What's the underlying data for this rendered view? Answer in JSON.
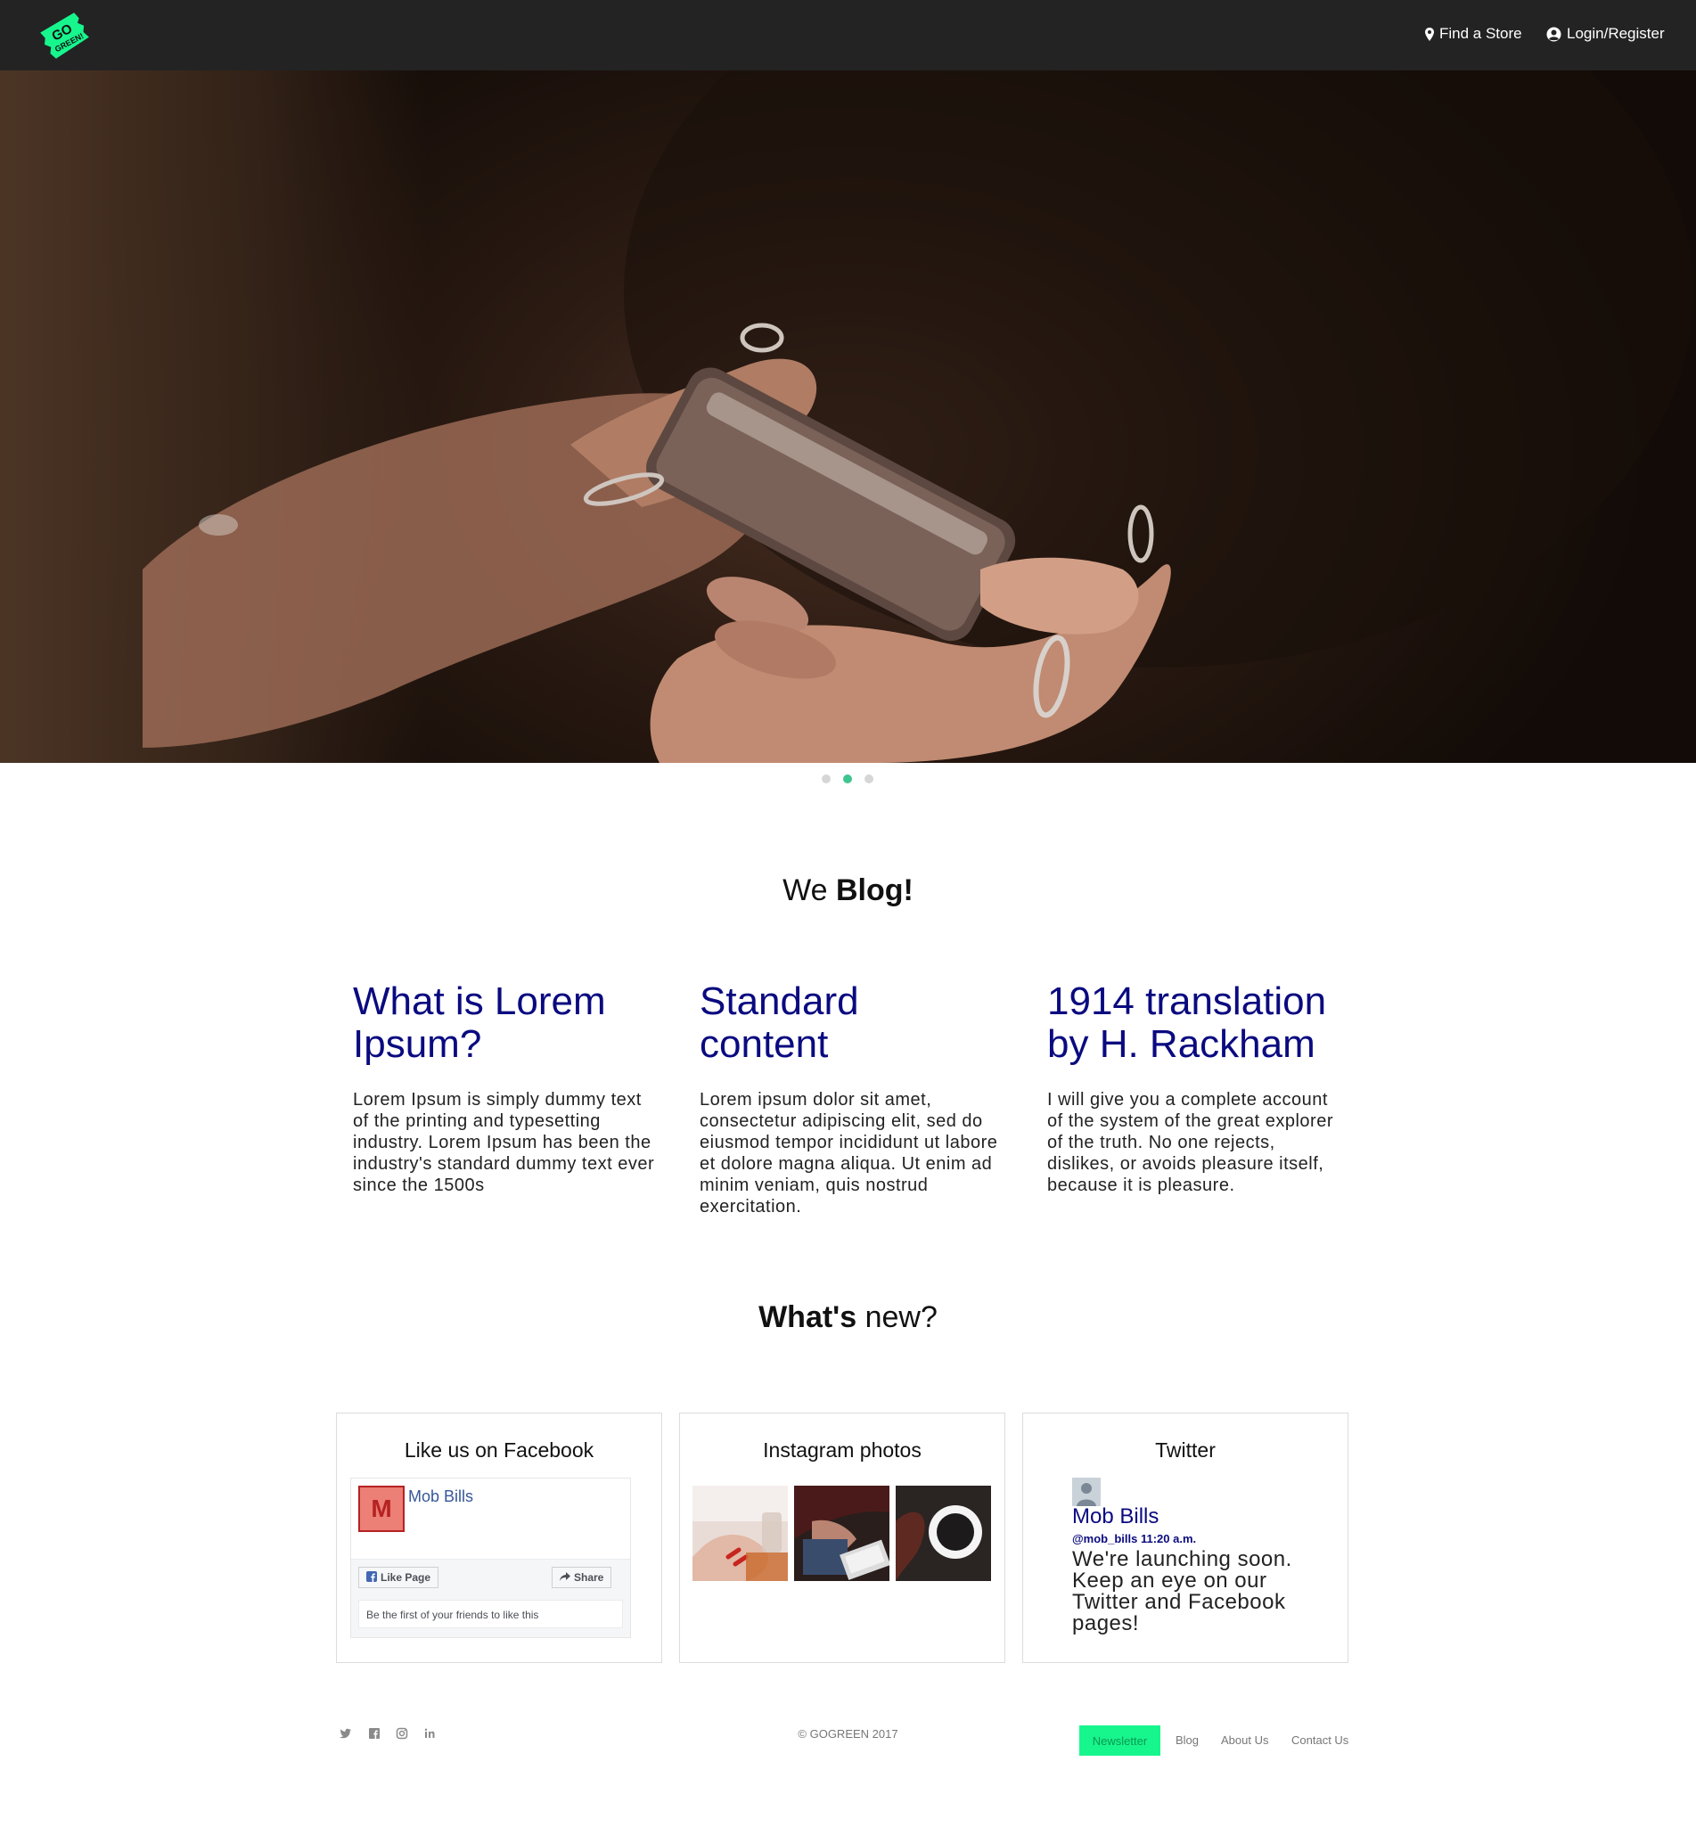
{
  "nav": {
    "find_store": "Find a Store",
    "login": "Login/Register",
    "logo_text_1": "GO",
    "logo_text_2": "GREEN!"
  },
  "blog": {
    "title_light": "We ",
    "title_bold": "Blog!",
    "posts": [
      {
        "title": "What is Lorem Ipsum?",
        "body": "Lorem Ipsum is simply dummy text of the printing and typesetting industry. Lorem Ipsum has been the industry's standard dummy text ever since the 1500s"
      },
      {
        "title": "Standard content",
        "body": "Lorem ipsum dolor sit amet, consectetur adipiscing elit, sed do eiusmod tempor incididunt ut labore et dolore magna aliqua. Ut enim ad minim veniam, quis nostrud exercitation."
      },
      {
        "title": "1914 translation by H. Rackham",
        "body": "I will give you a complete account of the system of the great explorer of the truth. No one rejects, dislikes, or avoids pleasure itself, because it is pleasure."
      }
    ]
  },
  "whats_new": {
    "title_bold": "What's",
    "title_light": " new?"
  },
  "facebook": {
    "card_title": "Like us on Facebook",
    "avatar_letter": "M",
    "page_name": "Mob Bills",
    "like_label": "Like Page",
    "share_label": "Share",
    "friends_text": "Be the first of your friends to like this"
  },
  "instagram": {
    "card_title": "Instagram photos"
  },
  "twitter": {
    "card_title": "Twitter",
    "name": "Mob Bills",
    "meta": "@mob_bills 11:20 a.m.",
    "text": "We're launching soon. Keep an eye on our Twitter and Facebook pages!"
  },
  "footer": {
    "copyright": "© GOGREEN 2017",
    "newsletter": "Newsletter",
    "blog": "Blog",
    "about": "About Us",
    "contact": "Contact Us"
  },
  "colors": {
    "accent": "#17f58d",
    "heading_blue": "#0a0a80",
    "navbar": "#232323",
    "active_dot": "#3fc58e"
  },
  "carousel": {
    "slides": 3,
    "active_index": 2
  },
  "icons": [
    "map-marker-icon",
    "user-circle-icon",
    "twitter-icon",
    "facebook-icon",
    "instagram-icon",
    "linkedin-icon",
    "share-icon"
  ]
}
